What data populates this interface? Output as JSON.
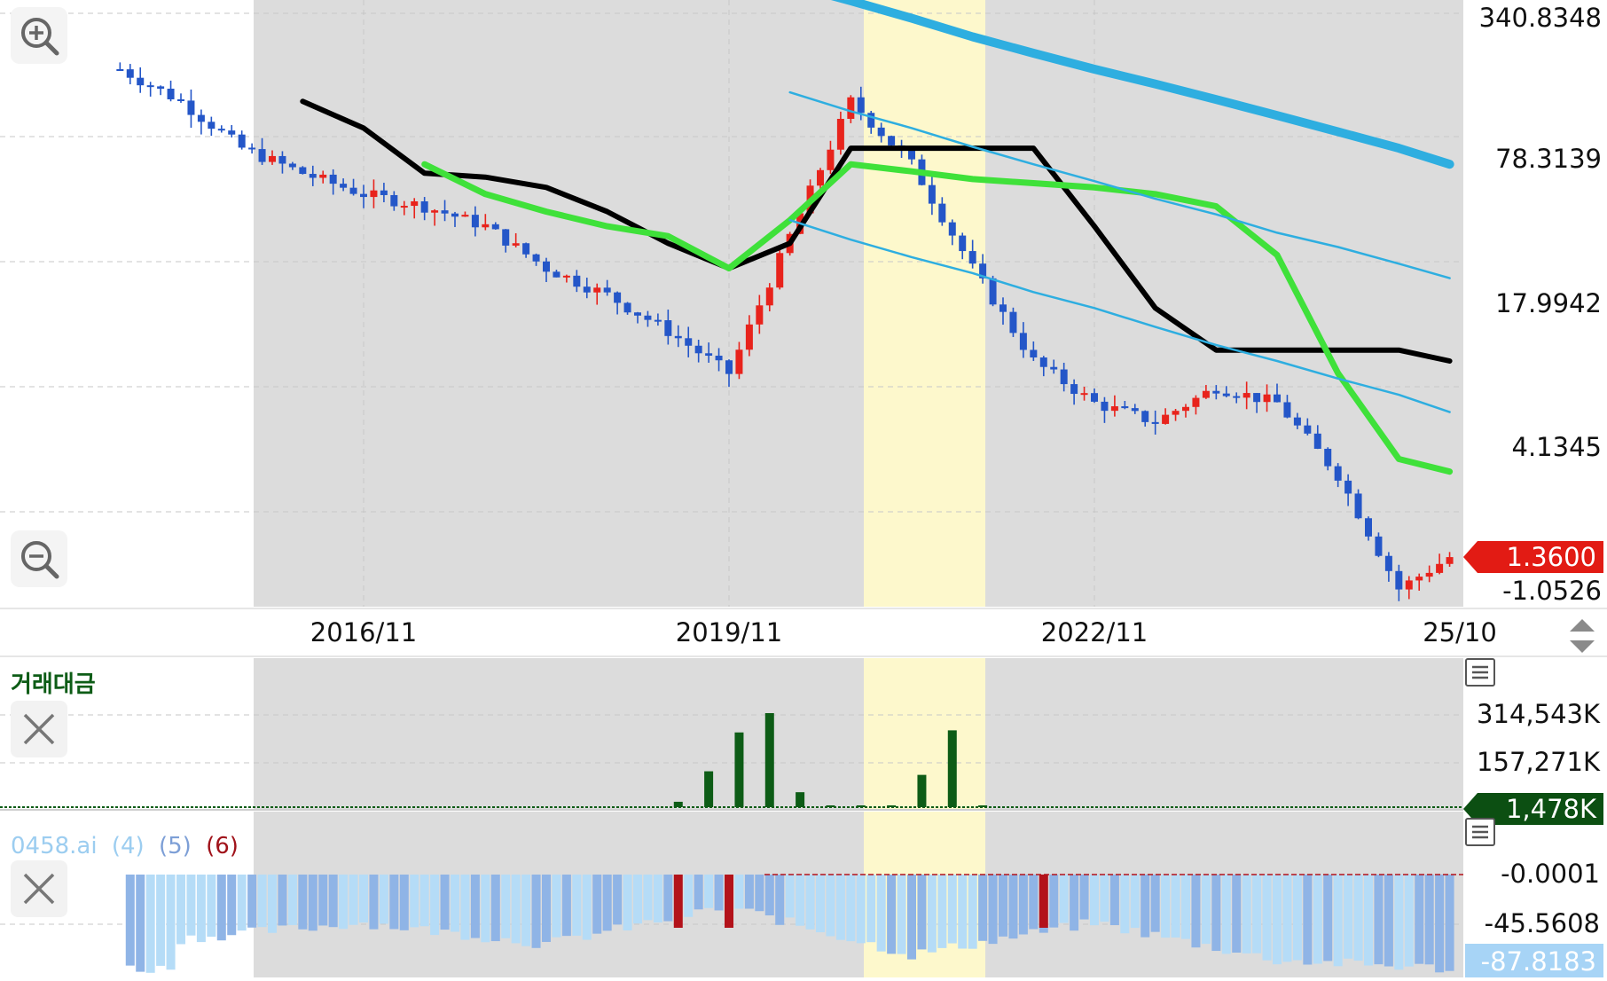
{
  "price_axis": {
    "labels": [
      "340.8348",
      "78.3139",
      "17.9942",
      "4.1345",
      "-1.0526"
    ],
    "current_badge": "1.3600"
  },
  "time_axis": {
    "labels": [
      "2016/11",
      "2019/11",
      "2022/11",
      "25/10"
    ]
  },
  "volume_panel": {
    "title": "거래대금",
    "labels": [
      "314,543K",
      "157,271K"
    ],
    "current_badge": "1,478K"
  },
  "indicator_panel": {
    "name": "0458.ai",
    "param_4": "(4)",
    "param_5": "(5)",
    "param_6": "(6)",
    "labels": [
      "-0.0001",
      "-45.5608"
    ],
    "current_badge": "-87.8183"
  },
  "icons": {
    "zoom_in": "zoom-in-icon",
    "zoom_out": "zoom-out-icon",
    "close": "close-icon",
    "menu": "menu-icon",
    "scroll": "up-down-arrows-icon"
  },
  "colors": {
    "up": "#e8231c",
    "down": "#2456c8",
    "black_line": "#000000",
    "green_line": "#3fe13a",
    "channel": "#2eaee0",
    "volume": "#0d5c16",
    "indicator_light": "#b5dcf7",
    "indicator_mid": "#8fb4e6",
    "indicator_neg": "#b3121a",
    "highlight": "#fdf8cc",
    "shade": "#dcdcdc"
  },
  "chart_data": [
    {
      "type": "candlestick",
      "y_scale": "log",
      "ylim": [
        -1.0526,
        340.8348
      ],
      "x_ticks": [
        "2016/11",
        "2019/11",
        "2022/11",
        "25/10"
      ],
      "y_ticks": [
        "340.8348",
        "78.3139",
        "17.9942",
        "4.1345",
        "-1.0526"
      ],
      "last_price": 1.36,
      "x": [
        "2014/11",
        "2015/05",
        "2015/11",
        "2016/05",
        "2016/11",
        "2017/05",
        "2017/11",
        "2018/05",
        "2018/11",
        "2019/05",
        "2019/11",
        "2020/05",
        "2020/11",
        "2021/05",
        "2021/11",
        "2022/05",
        "2022/11",
        "2023/05",
        "2023/11",
        "2024/05",
        "2024/11",
        "2025/05",
        "2025/10"
      ],
      "series": [
        {
          "values": [
            150,
            110,
            70,
            55,
            45,
            40,
            33,
            22,
            17,
            12,
            8,
            30,
            110,
            60,
            22,
            9,
            6,
            5,
            7,
            6,
            3,
            1.0,
            1.36
          ]
        },
        {
          "values": [
            null,
            null,
            null,
            110,
            85,
            55,
            53,
            48,
            38,
            28,
            22,
            28,
            70,
            70,
            70,
            70,
            33,
            15,
            10,
            10,
            10,
            10,
            9
          ]
        },
        {
          "values": [
            null,
            null,
            null,
            null,
            null,
            60,
            45,
            38,
            33,
            30,
            22,
            35,
            60,
            56,
            52,
            50,
            48,
            45,
            40,
            25,
            8,
            3.5,
            3.1
          ]
        },
        {
          "values": [
            null,
            null,
            null,
            null,
            null,
            null,
            null,
            null,
            null,
            null,
            null,
            340,
            290,
            245,
            205,
            175,
            150,
            130,
            112,
            96,
            82,
            70,
            60
          ]
        },
        {
          "values": [
            null,
            null,
            null,
            null,
            null,
            null,
            null,
            null,
            null,
            null,
            null,
            120,
            100,
            85,
            71,
            60,
            51,
            43,
            37,
            31,
            27,
            23,
            20
          ]
        },
        {
          "values": [
            null,
            null,
            null,
            null,
            null,
            null,
            null,
            null,
            null,
            null,
            null,
            35,
            29,
            24.5,
            21,
            17.5,
            15,
            12.5,
            10.5,
            9,
            7.6,
            6.5,
            5.5
          ]
        }
      ]
    },
    {
      "type": "bar",
      "title": "거래대금",
      "y_ticks": [
        "314,543K",
        "157,271K"
      ],
      "last_value": "1,478K",
      "x": [
        "2019/06",
        "2019/09",
        "2019/12",
        "2020/03",
        "2020/06",
        "2020/09",
        "2020/12",
        "2021/03",
        "2021/06",
        "2021/09",
        "2021/12"
      ],
      "values": [
        18000,
        120000,
        250000,
        314543,
        50000,
        5000,
        1500,
        1200,
        108000,
        257000,
        1478
      ]
    },
    {
      "type": "bar",
      "title": "0458.ai (4) (5) (6)",
      "y_ticks": [
        "-0.0001",
        "-45.5608"
      ],
      "last_value": "-87.8183",
      "x": [
        "2015/05",
        "2016/11",
        "2018/05",
        "2019/11",
        "2021/05",
        "2022/11",
        "2024/05",
        "2025/10"
      ],
      "values": [
        -60,
        -45,
        -65,
        -30,
        -75,
        -45,
        -80,
        -87.8183
      ]
    }
  ]
}
